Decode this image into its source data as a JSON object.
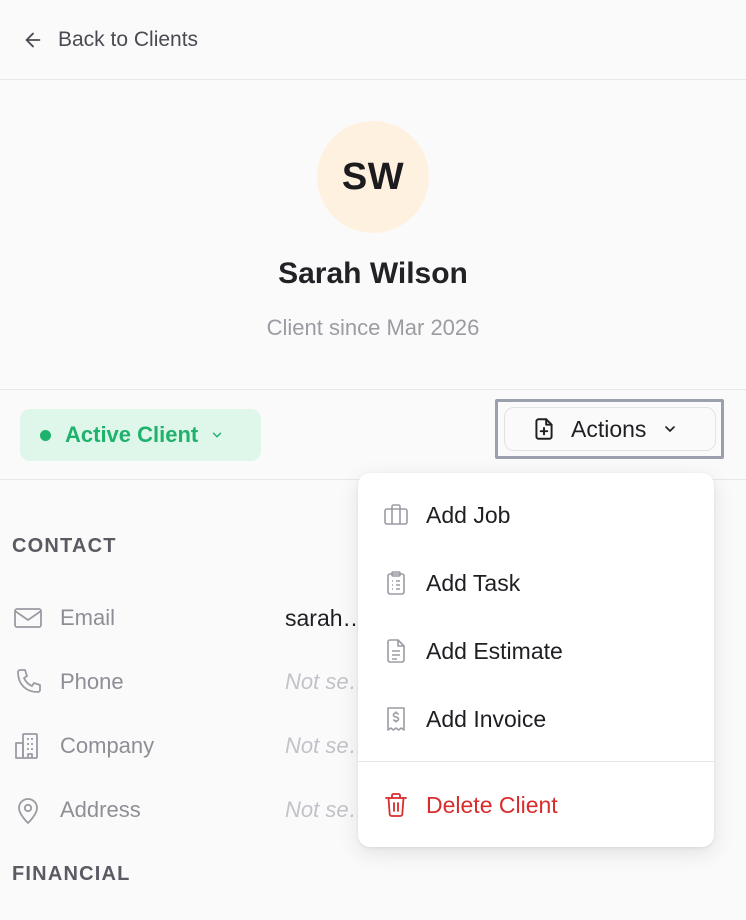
{
  "nav": {
    "back_label": "Back to Clients"
  },
  "profile": {
    "initials": "SW",
    "name": "Sarah Wilson",
    "since": "Client since Mar 2026",
    "avatar_bg": "#fff1df"
  },
  "status": {
    "label": "Active Client",
    "color": "#1eb26d",
    "bg": "#dff6ea"
  },
  "actions": {
    "label": "Actions",
    "menu": [
      {
        "label": "Add Job",
        "icon": "briefcase-icon"
      },
      {
        "label": "Add Task",
        "icon": "clipboard-list-icon"
      },
      {
        "label": "Add Estimate",
        "icon": "document-icon"
      },
      {
        "label": "Add Invoice",
        "icon": "invoice-dollar-icon"
      }
    ],
    "delete": {
      "label": "Delete Client",
      "icon": "trash-icon",
      "color": "#d92c2c"
    }
  },
  "contact": {
    "title": "CONTACT",
    "rows": [
      {
        "label": "Email",
        "value": "sarah…",
        "icon": "mail-icon"
      },
      {
        "label": "Phone",
        "value": "Not se…",
        "icon": "phone-icon"
      },
      {
        "label": "Company",
        "value": "Not se…",
        "icon": "building-icon"
      },
      {
        "label": "Address",
        "value": "Not se…",
        "icon": "map-pin-icon"
      }
    ]
  },
  "financial": {
    "title": "FINANCIAL"
  }
}
